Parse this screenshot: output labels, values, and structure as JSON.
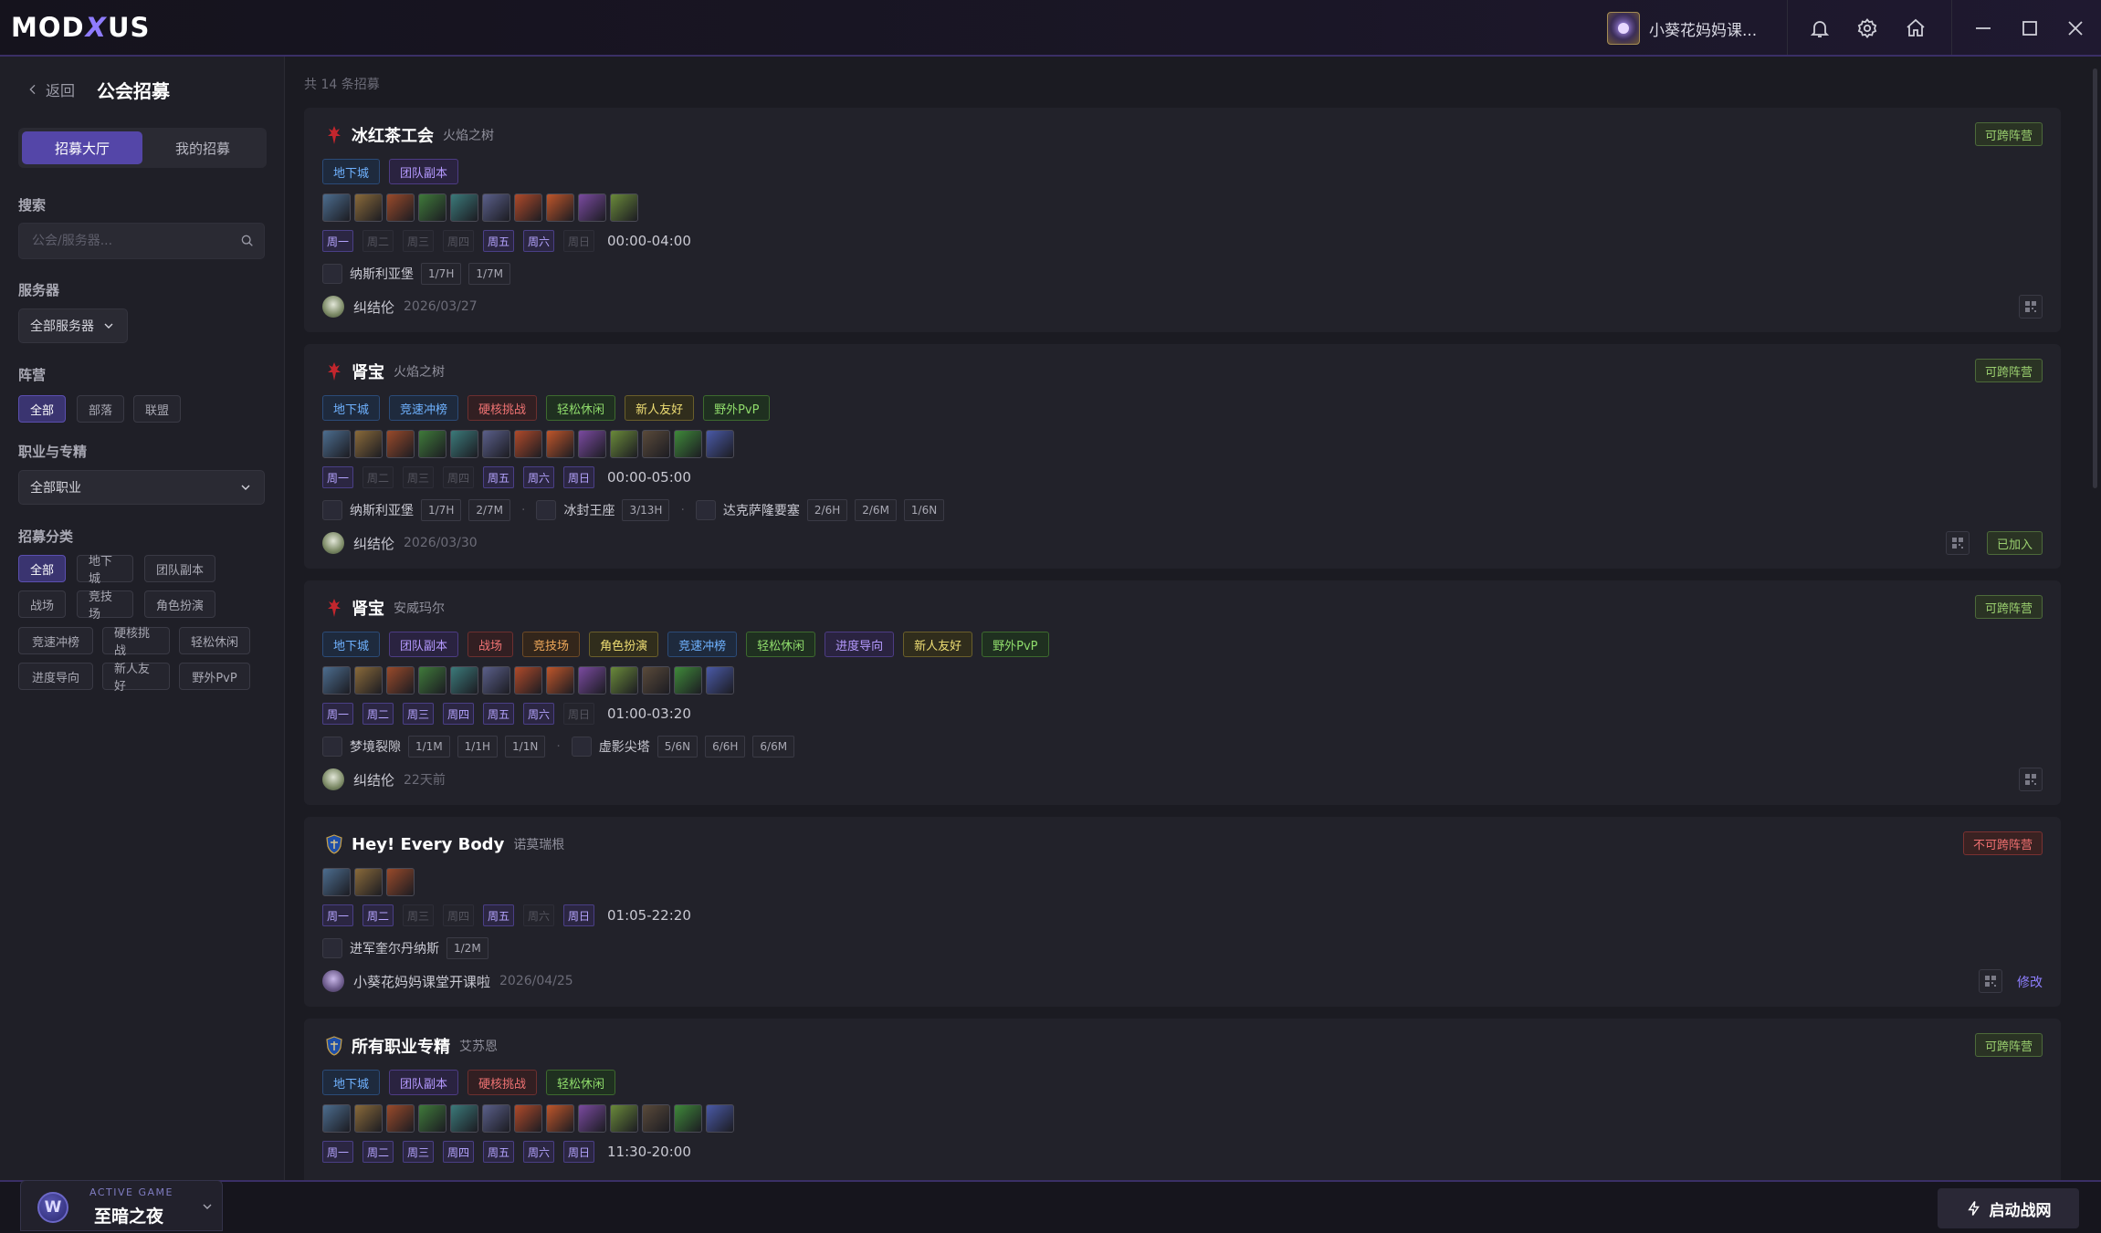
{
  "app": {
    "logo": "MODXUS",
    "user_name": "小葵花妈妈课..."
  },
  "sidebar": {
    "back": "返回",
    "title": "公会招募",
    "tabs": [
      "招募大厅",
      "我的招募"
    ],
    "search_label": "搜索",
    "search_placeholder": "公会/服务器...",
    "server_label": "服务器",
    "server_value": "全部服务器",
    "faction_label": "阵营",
    "factions": [
      "全部",
      "部落",
      "联盟"
    ],
    "class_label": "职业与专精",
    "class_value": "全部职业",
    "category_label": "招募分类",
    "categories": [
      "全部",
      "地下城",
      "团队副本",
      "战场",
      "竞技场",
      "角色扮演",
      "竞速冲榜",
      "硬核挑战",
      "轻松休闲",
      "进度导向",
      "新人友好",
      "野外PvP"
    ]
  },
  "active_game": {
    "label": "ACTIVE GAME",
    "name": "至暗之夜"
  },
  "launch_label": "启动战网",
  "main": {
    "count_text": "共 14 条招募",
    "weekdays": [
      "周一",
      "周二",
      "周三",
      "周四",
      "周五",
      "周六",
      "周日"
    ],
    "cards": [
      {
        "faction": "horde",
        "name": "冰红茶工会",
        "server": "火焰之树",
        "cross": "可跨阵营",
        "cross_ok": true,
        "tags": [
          {
            "t": "地下城",
            "c": "blue"
          },
          {
            "t": "团队副本",
            "c": "purple"
          }
        ],
        "icons": 10,
        "days_on": [
          0,
          4,
          5
        ],
        "time": "00:00-04:00",
        "progress": [
          {
            "name": "纳斯利亚堡",
            "badges": [
              "1/7H",
              "1/7M"
            ]
          }
        ],
        "leader": "纠结伦",
        "date": "2026/03/27",
        "joined": "",
        "edit": ""
      },
      {
        "faction": "horde",
        "name": "肾宝",
        "server": "火焰之树",
        "cross": "可跨阵营",
        "cross_ok": true,
        "tags": [
          {
            "t": "地下城",
            "c": "blue"
          },
          {
            "t": "竞速冲榜",
            "c": "blue"
          },
          {
            "t": "硬核挑战",
            "c": "red"
          },
          {
            "t": "轻松休闲",
            "c": "green"
          },
          {
            "t": "新人友好",
            "c": "yellow"
          },
          {
            "t": "野外PvP",
            "c": "green"
          }
        ],
        "icons": 13,
        "days_on": [
          0,
          4,
          5,
          6
        ],
        "time": "00:00-05:00",
        "progress": [
          {
            "name": "纳斯利亚堡",
            "badges": [
              "1/7H",
              "2/7M"
            ]
          },
          {
            "name": "冰封王座",
            "badges": [
              "3/13H"
            ]
          },
          {
            "name": "达克萨隆要塞",
            "badges": [
              "2/6H",
              "2/6M",
              "1/6N"
            ]
          }
        ],
        "leader": "纠结伦",
        "date": "2026/03/30",
        "joined": "已加入",
        "edit": ""
      },
      {
        "faction": "horde",
        "name": "肾宝",
        "server": "安威玛尔",
        "cross": "可跨阵营",
        "cross_ok": true,
        "tags": [
          {
            "t": "地下城",
            "c": "blue"
          },
          {
            "t": "团队副本",
            "c": "purple"
          },
          {
            "t": "战场",
            "c": "red"
          },
          {
            "t": "竞技场",
            "c": "orange"
          },
          {
            "t": "角色扮演",
            "c": "yellow"
          },
          {
            "t": "竞速冲榜",
            "c": "blue"
          },
          {
            "t": "轻松休闲",
            "c": "green"
          },
          {
            "t": "进度导向",
            "c": "purple"
          },
          {
            "t": "新人友好",
            "c": "yellow"
          },
          {
            "t": "野外PvP",
            "c": "green"
          }
        ],
        "icons": 13,
        "days_on": [
          0,
          1,
          2,
          3,
          4,
          5
        ],
        "time": "01:00-03:20",
        "progress": [
          {
            "name": "梦境裂隙",
            "badges": [
              "1/1M",
              "1/1H",
              "1/1N"
            ]
          },
          {
            "name": "虚影尖塔",
            "badges": [
              "5/6N",
              "6/6H",
              "6/6M"
            ]
          }
        ],
        "leader": "纠结伦",
        "date": "22天前",
        "joined": "",
        "edit": ""
      },
      {
        "faction": "alliance",
        "name": "Hey! Every Body",
        "server": "诺莫瑞根",
        "cross": "不可跨阵营",
        "cross_ok": false,
        "tags": [],
        "icons": 3,
        "days_on": [
          0,
          1,
          4,
          6
        ],
        "time": "01:05-22:20",
        "progress": [
          {
            "name": "进军奎尔丹纳斯",
            "badges": [
              "1/2M"
            ]
          }
        ],
        "leader": "小葵花妈妈课堂开课啦",
        "date": "2026/04/25",
        "joined": "",
        "edit": "修改"
      },
      {
        "faction": "alliance",
        "name": "所有职业专精",
        "server": "艾苏恩",
        "cross": "可跨阵营",
        "cross_ok": true,
        "tags": [
          {
            "t": "地下城",
            "c": "blue"
          },
          {
            "t": "团队副本",
            "c": "purple"
          },
          {
            "t": "硬核挑战",
            "c": "red"
          },
          {
            "t": "轻松休闲",
            "c": "green"
          }
        ],
        "icons": 13,
        "days_on": [
          0,
          1,
          2,
          3,
          4,
          5,
          6
        ],
        "time": "11:30-20:00",
        "progress": [],
        "leader": "",
        "date": "",
        "joined": "",
        "edit": ""
      }
    ]
  }
}
